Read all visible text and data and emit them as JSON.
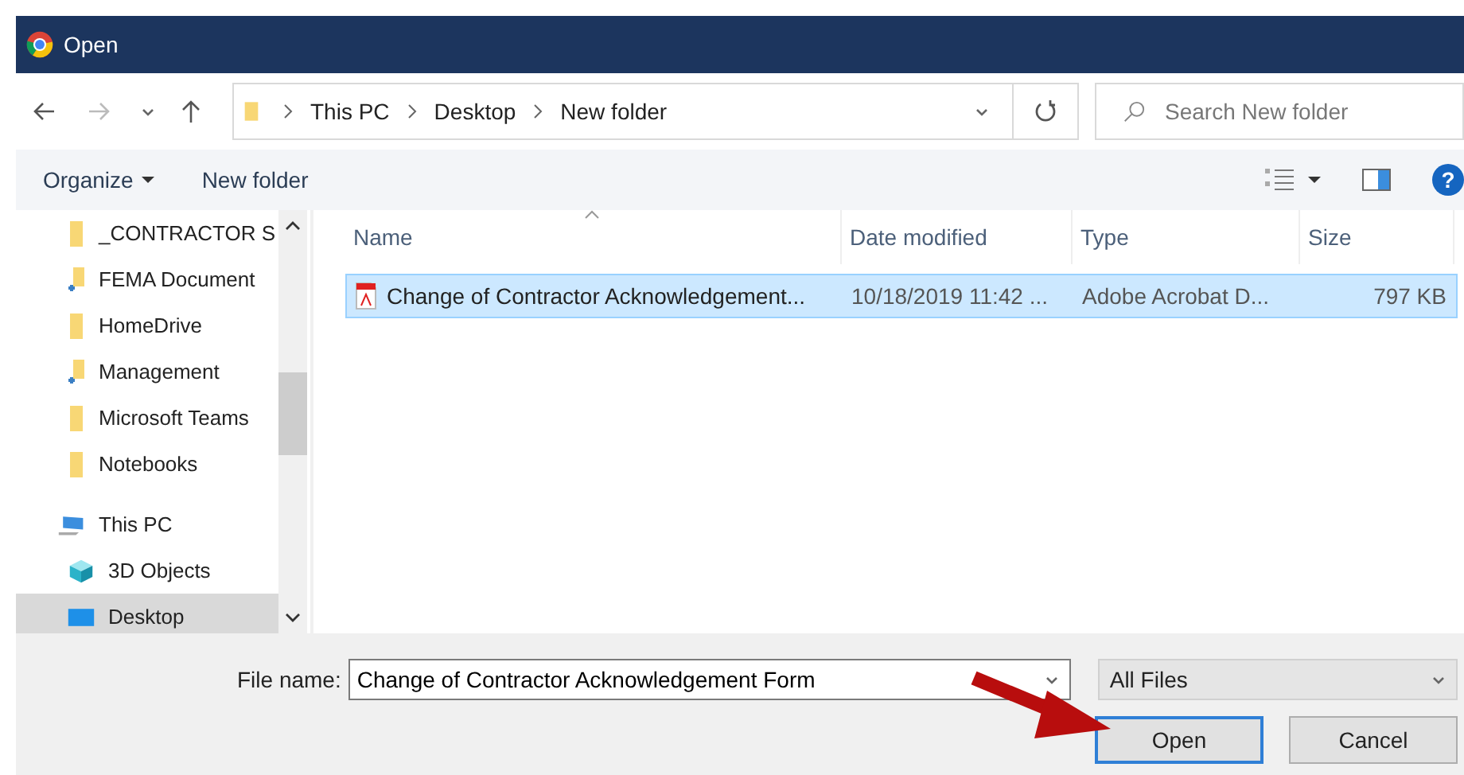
{
  "window": {
    "title": "Open"
  },
  "address": {
    "crumbs": [
      "This PC",
      "Desktop",
      "New folder"
    ]
  },
  "search": {
    "placeholder": "Search New folder"
  },
  "toolbar": {
    "organize": "Organize",
    "new_folder": "New folder",
    "help": "?"
  },
  "sidebar": {
    "items": [
      {
        "label": "_CONTRACTOR S",
        "kind": "folder",
        "selected": false
      },
      {
        "label": "FEMA Document",
        "kind": "shared",
        "selected": false
      },
      {
        "label": "HomeDrive",
        "kind": "folder",
        "selected": false
      },
      {
        "label": "Management",
        "kind": "shared",
        "selected": false
      },
      {
        "label": "Microsoft Teams",
        "kind": "folder",
        "selected": false
      },
      {
        "label": "Notebooks",
        "kind": "folder",
        "selected": false
      },
      {
        "label": "This PC",
        "kind": "pc",
        "selected": false
      },
      {
        "label": "3D Objects",
        "kind": "objects",
        "selected": false
      },
      {
        "label": "Desktop",
        "kind": "desktop",
        "selected": true
      }
    ]
  },
  "table": {
    "columns": [
      "Name",
      "Date modified",
      "Type",
      "Size"
    ],
    "rows": [
      {
        "cells": [
          "Change of Contractor Acknowledgement...",
          "10/18/2019 11:42 ...",
          "Adobe Acrobat D...",
          "797 KB"
        ],
        "selected": true
      }
    ]
  },
  "footer": {
    "file_name_label": "File name:",
    "file_name": "Change of Contractor Acknowledgement Form",
    "filter": "All Files",
    "open": "Open",
    "cancel": "Cancel"
  }
}
